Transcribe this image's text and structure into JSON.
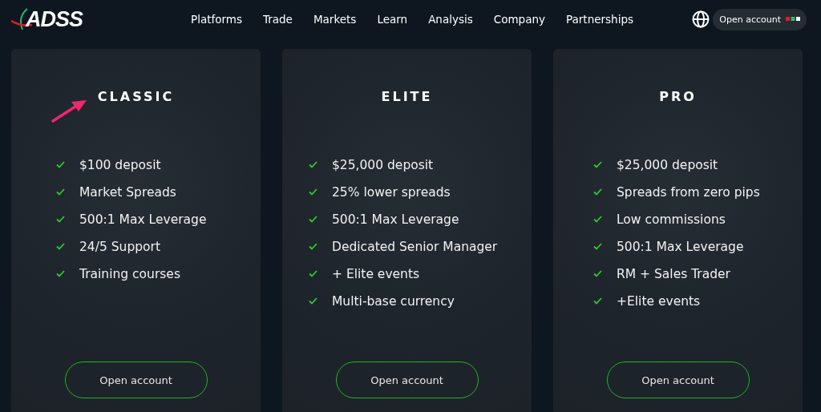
{
  "logo": {
    "text": "ADSS"
  },
  "nav": [
    "Platforms",
    "Trade",
    "Markets",
    "Learn",
    "Analysis",
    "Company",
    "Partnerships"
  ],
  "header_button": {
    "label": "Open account"
  },
  "plans": [
    {
      "name": "CLASSIC",
      "annotated": true,
      "features": [
        "$100 deposit",
        "Market Spreads",
        "500:1 Max Leverage",
        "24/5 Support",
        "Training courses"
      ],
      "button": "Open account"
    },
    {
      "name": "ELITE",
      "annotated": false,
      "features": [
        "$25,000 deposit",
        "25% lower spreads",
        "500:1 Max Leverage",
        "Dedicated Senior Manager",
        "+ Elite events",
        "Multi-base currency"
      ],
      "button": "Open account"
    },
    {
      "name": "PRO",
      "annotated": false,
      "features": [
        "$25,000 deposit",
        "Spreads from zero pips",
        "Low commissions",
        "500:1 Max Leverage",
        "RM + Sales Trader",
        "+Elite events"
      ],
      "button": "Open account"
    }
  ]
}
